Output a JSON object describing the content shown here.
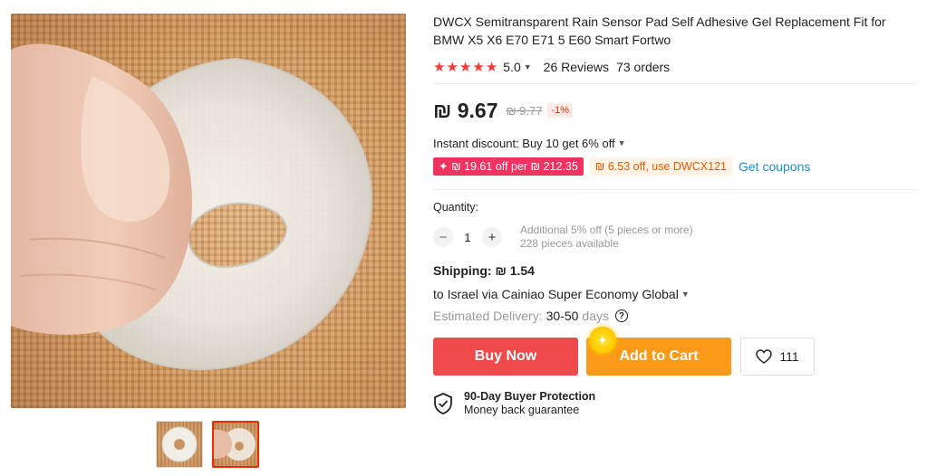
{
  "product": {
    "title": "DWCX Semitransparent Rain Sensor Pad Self Adhesive Gel Replacement Fit for BMW X5 X6 E70 E71 5 E60 Smart Fortwo",
    "rating": "5.0",
    "reviews": "26 Reviews",
    "orders": "73 orders",
    "star_color": "#f03a3a"
  },
  "price": {
    "current": "₪ 9.67",
    "original": "₪ 9.77",
    "discount": "-1%",
    "instant_discount": "Instant discount: Buy 10 get 6% off"
  },
  "coupons": {
    "deal_badge": "₪ 19.61 off per ₪ 212.35",
    "code_badge": "₪ 6.53 off, use DWCX121",
    "get_coupons": "Get coupons"
  },
  "quantity": {
    "label": "Quantity:",
    "value": "1",
    "note_1": "Additional 5% off (5 pieces or more)",
    "note_2": "228 pieces available"
  },
  "shipping": {
    "label": "Shipping:",
    "price": "₪ 1.54",
    "destination": "to Israel via Cainiao Super Economy Global",
    "delivery_label": "Estimated Delivery:",
    "delivery_days": "30-50",
    "delivery_unit": "days"
  },
  "actions": {
    "buy_now": "Buy Now",
    "add_to_cart": "Add to Cart",
    "wishlist_count": "111"
  },
  "protection": {
    "title": "90-Day Buyer Protection",
    "subtitle": "Money back guarantee"
  },
  "colors": {
    "buy_now": "#f0494b",
    "add_to_cart": "#fb9a19",
    "coupon_red": "#f0345f",
    "coupon_orange_text": "#e85a00",
    "link": "#1f8ccf",
    "active_thumb_border": "#e62e04"
  },
  "icons": [
    "star-icon",
    "chevron-down-icon",
    "minus-icon",
    "plus-icon",
    "help-icon",
    "heart-icon",
    "shield-check-icon",
    "sparkle-icon"
  ]
}
